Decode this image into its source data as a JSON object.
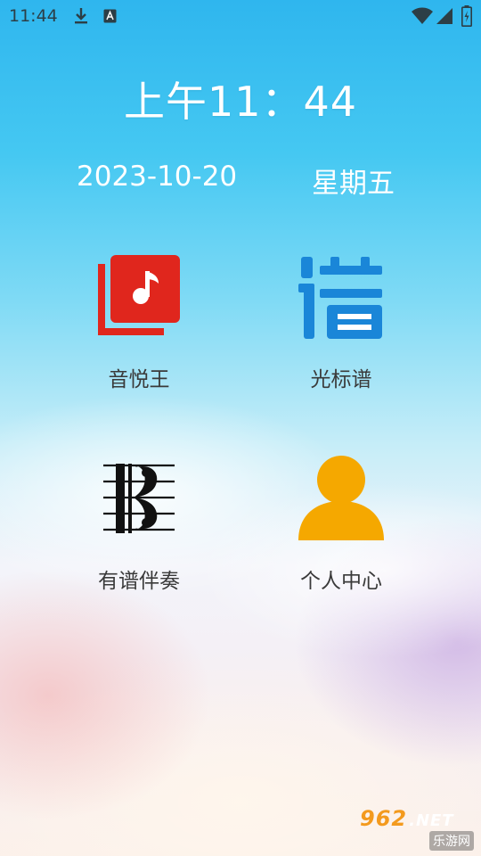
{
  "status_bar": {
    "time": "11:44",
    "icons": [
      "download-icon",
      "keyboard-a-icon",
      "wifi-icon",
      "signal-icon",
      "battery-charging-icon"
    ]
  },
  "clock": {
    "time_text": "上午11：44",
    "date_text": "2023-10-20",
    "weekday_text": "星期五"
  },
  "apps": [
    {
      "label": "音悦王",
      "icon": "music-album-icon",
      "color": "#e0261d"
    },
    {
      "label": "光标谱",
      "icon": "pu-character-icon",
      "color": "#1a86d8"
    },
    {
      "label": "有谱伴奏",
      "icon": "clef-staff-icon",
      "color": "#111111"
    },
    {
      "label": "个人中心",
      "icon": "person-icon",
      "color": "#f5a800"
    }
  ],
  "watermark": {
    "brand": "962",
    "suffix": ".NET",
    "site": "乐游网"
  }
}
